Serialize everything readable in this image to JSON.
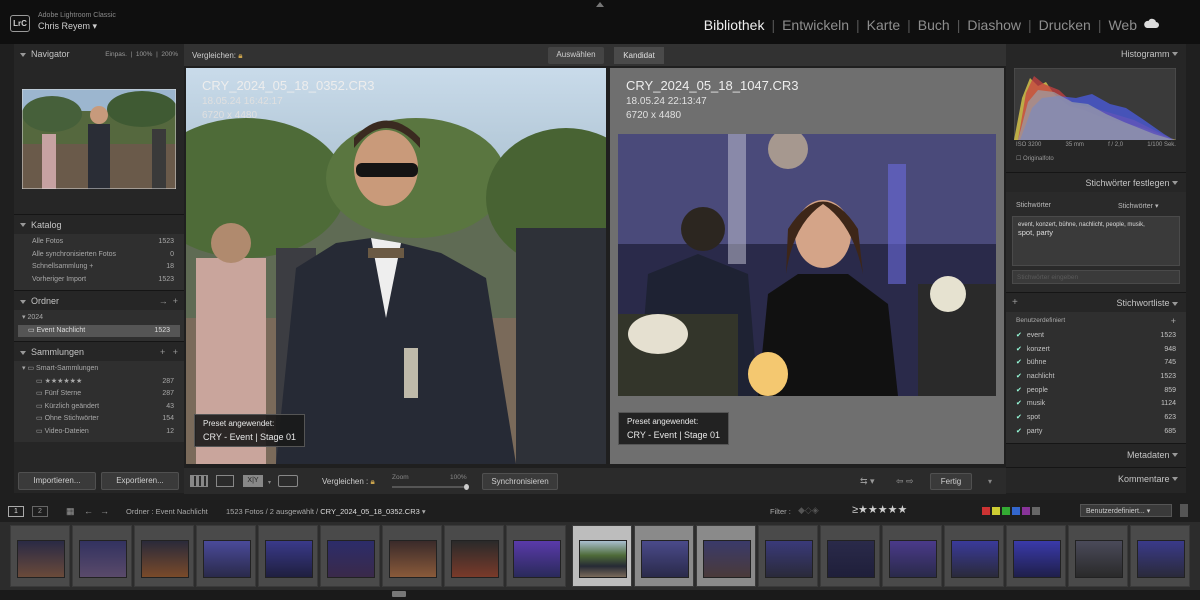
{
  "app": {
    "name": "Adobe Lightroom Classic",
    "user": "Chris Reyem",
    "logo": "LrC"
  },
  "modules": [
    "Bibliothek",
    "Entwickeln",
    "Karte",
    "Buch",
    "Diashow",
    "Drucken",
    "Web"
  ],
  "navigator": {
    "title": "Navigator",
    "zoom": [
      "Einpas.",
      "100%",
      "200%"
    ]
  },
  "katalog": {
    "title": "Katalog",
    "items": [
      {
        "label": "Alle Fotos",
        "count": "1523"
      },
      {
        "label": "Alle synchronisierten Fotos",
        "count": "0"
      },
      {
        "label": "Schnellsammlung +",
        "count": "18"
      },
      {
        "label": "Vorheriger Import",
        "count": "1523"
      }
    ]
  },
  "ordner": {
    "title": "Ordner",
    "year": "2024",
    "folder": "Event Nachlicht",
    "count": "1523"
  },
  "sammlungen": {
    "title": "Sammlungen",
    "group": "Smart-Sammlungen",
    "items": [
      {
        "label": "★★★★★★",
        "count": "287"
      },
      {
        "label": "Fünf Sterne",
        "count": "287"
      },
      {
        "label": "Kürzlich geändert",
        "count": "43"
      },
      {
        "label": "Ohne Stichwörter",
        "count": "154"
      },
      {
        "label": "Video-Dateien",
        "count": "12"
      }
    ]
  },
  "import_label": "Importieren...",
  "export_label": "Exportieren...",
  "compare": {
    "select_label": "Vergleichen:",
    "select_btn": "Auswählen",
    "candidate_label": "Kandidat",
    "left": {
      "file": "CRY_2024_05_18_0352.CR3",
      "date": "18.05.24 16:42:17",
      "dims": "6720 x 4480"
    },
    "right": {
      "file": "CRY_2024_05_18_1047.CR3",
      "date": "18.05.24 22:13:47",
      "dims": "6720 x 4480"
    },
    "preset_label": "Preset angewendet:",
    "preset_value": "CRY - Event | Stage 01"
  },
  "toolbar": {
    "compare_label": "Vergleichen :",
    "zoom_label": "Zoom",
    "zoom_value": "100%",
    "sync": "Synchronisieren",
    "done": "Fertig"
  },
  "histogram": {
    "title": "Histogramm",
    "iso": "ISO 3200",
    "focal": "35 mm",
    "aperture": "f / 2,0",
    "shutter": "1/100 Sek.",
    "original": "Originalfoto"
  },
  "keywording": {
    "title": "Stichwörter festlegen",
    "label": "Stichwörter",
    "dropdown": "Stichwörter",
    "tags": "event, konzert, bühne, nachlicht, people, musik,",
    "tags2": "spot, party",
    "placeholder": "Stichwörter eingeben"
  },
  "keyword_list": {
    "title": "Stichwortliste",
    "filter": "Benutzerdefiniert",
    "items": [
      {
        "label": "event",
        "count": "1523"
      },
      {
        "label": "konzert",
        "count": "948"
      },
      {
        "label": "bühne",
        "count": "745"
      },
      {
        "label": "nachlicht",
        "count": "1523"
      },
      {
        "label": "people",
        "count": "859"
      },
      {
        "label": "musik",
        "count": "1124"
      },
      {
        "label": "spot",
        "count": "623"
      },
      {
        "label": "party",
        "count": "685"
      }
    ]
  },
  "metadaten": "Metadaten",
  "kommentare": "Kommentare",
  "filmstrip": {
    "page1": "1",
    "page2": "2",
    "source": "Ordner : Event Nachlicht",
    "summary": "1523 Fotos / 2 ausgewählt /",
    "current": "CRY_2024_05_18_0352.CR3",
    "filter_label": "Filter :",
    "filter_value": "Benutzerdefiniert..."
  },
  "colors": {
    "accent": "#efefef",
    "panel": "#262626",
    "bg": "#0f0f0f"
  }
}
